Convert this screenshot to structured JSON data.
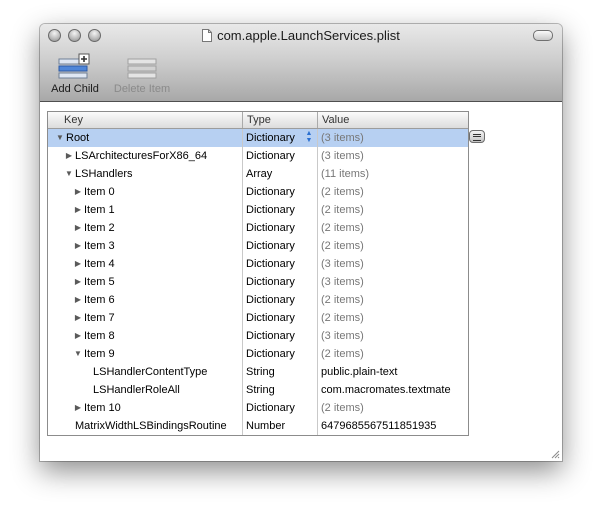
{
  "window": {
    "title": "com.apple.LaunchServices.plist"
  },
  "toolbar": {
    "add_child_label": "Add Child",
    "delete_item_label": "Delete Item"
  },
  "columns": {
    "key": "Key",
    "type": "Type",
    "value": "Value"
  },
  "rows": [
    {
      "key": "Root",
      "type": "Dictionary",
      "value": "(3 items)",
      "disclosure": "expanded",
      "selected": true
    },
    {
      "key": "LSArchitecturesForX86_64",
      "type": "Dictionary",
      "value": "(3 items)",
      "disclosure": "collapsed"
    },
    {
      "key": "LSHandlers",
      "type": "Array",
      "value": "(11 items)",
      "disclosure": "expanded"
    },
    {
      "key": "Item 0",
      "type": "Dictionary",
      "value": "(2 items)",
      "disclosure": "collapsed"
    },
    {
      "key": "Item 1",
      "type": "Dictionary",
      "value": "(2 items)",
      "disclosure": "collapsed"
    },
    {
      "key": "Item 2",
      "type": "Dictionary",
      "value": "(2 items)",
      "disclosure": "collapsed"
    },
    {
      "key": "Item 3",
      "type": "Dictionary",
      "value": "(2 items)",
      "disclosure": "collapsed"
    },
    {
      "key": "Item 4",
      "type": "Dictionary",
      "value": "(3 items)",
      "disclosure": "collapsed"
    },
    {
      "key": "Item 5",
      "type": "Dictionary",
      "value": "(3 items)",
      "disclosure": "collapsed"
    },
    {
      "key": "Item 6",
      "type": "Dictionary",
      "value": "(2 items)",
      "disclosure": "collapsed"
    },
    {
      "key": "Item 7",
      "type": "Dictionary",
      "value": "(2 items)",
      "disclosure": "collapsed"
    },
    {
      "key": "Item 8",
      "type": "Dictionary",
      "value": "(3 items)",
      "disclosure": "collapsed"
    },
    {
      "key": "Item 9",
      "type": "Dictionary",
      "value": "(2 items)",
      "disclosure": "expanded"
    },
    {
      "key": "LSHandlerContentType",
      "type": "String",
      "value": "public.plain-text",
      "disclosure": "none"
    },
    {
      "key": "LSHandlerRoleAll",
      "type": "String",
      "value": "com.macromates.textmate",
      "disclosure": "none"
    },
    {
      "key": "Item 10",
      "type": "Dictionary",
      "value": "(2 items)",
      "disclosure": "collapsed"
    },
    {
      "key": "MatrixWidthLSBindingsRoutine",
      "type": "Number",
      "value": "6479685567511851935",
      "disclosure": "none"
    }
  ],
  "icons": {
    "close": "close-button-icon",
    "minimize": "minimize-button-icon",
    "zoom": "zoom-button-icon",
    "document": "document-icon",
    "add_child": "add-child-icon",
    "delete_item": "delete-item-icon",
    "row_actions": "row-actions-icon",
    "resize": "resize-grip-icon"
  },
  "colors": {
    "selection": "#b7d0f2",
    "stepper": "#2a6fd1"
  }
}
